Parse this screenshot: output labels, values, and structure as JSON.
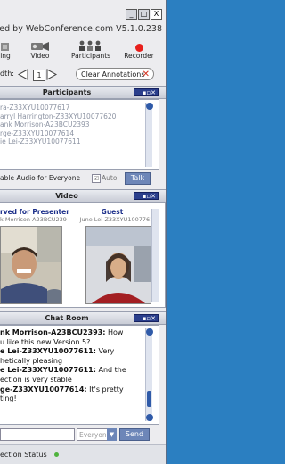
{
  "app": {
    "brand": "red by WebConference.com  V5.1.0.238"
  },
  "window_controls": {
    "minimize": "_",
    "maximize": "□",
    "close": "X"
  },
  "toolbar": {
    "items": [
      {
        "label": "ing"
      },
      {
        "label": "Video"
      },
      {
        "label": "Participants"
      },
      {
        "label": "Recorder"
      }
    ]
  },
  "line_options": {
    "label": "dth:",
    "value": "1",
    "clear_label": "Clear Annotations"
  },
  "participants_panel": {
    "title": "Participants",
    "names": [
      "ra-Z33XYU10077617",
      "arryl Harrington-Z33XYU10077620",
      "ank Morrison-A23BCU2393",
      "rge-Z33XYU10077614",
      "ie Lei-Z33XYU10077611"
    ],
    "enable_audio_label": "able Audio for Everyone",
    "auto_label": "Auto",
    "auto_checked": "☑",
    "talk_label": "Talk"
  },
  "video_panel": {
    "title": "Video",
    "presenter": {
      "role": "rved for Presenter",
      "name": "k Morrison-A23BCU239"
    },
    "guest": {
      "role": "Guest",
      "name": "June Lei-Z33XYU10077611"
    }
  },
  "chat_panel": {
    "title": "Chat Room",
    "messages": [
      {
        "sender": "nk Morrison-A23BCU2393:",
        "text": " How"
      },
      {
        "sender": "",
        "text": "u like this new Version 5?"
      },
      {
        "sender": "e Lei-Z33XYU10077611:",
        "text": " Very"
      },
      {
        "sender": "",
        "text": "hetically pleasing"
      },
      {
        "sender": "e Lei-Z33XYU10077611:",
        "text": " And the"
      },
      {
        "sender": "",
        "text": "ection is very stable"
      },
      {
        "sender": "ge-Z33XYU10077614:",
        "text": " It's pretty"
      },
      {
        "sender": "",
        "text": "ting!"
      }
    ],
    "recipient_value": "Everyon",
    "send_label": "Send"
  },
  "status": {
    "label": "ection Status"
  },
  "colors": {
    "desktop": "#2b7fc1",
    "record": "#e8201c",
    "status_ok": "#4fb33e",
    "accent_button": "#6d86b8"
  }
}
